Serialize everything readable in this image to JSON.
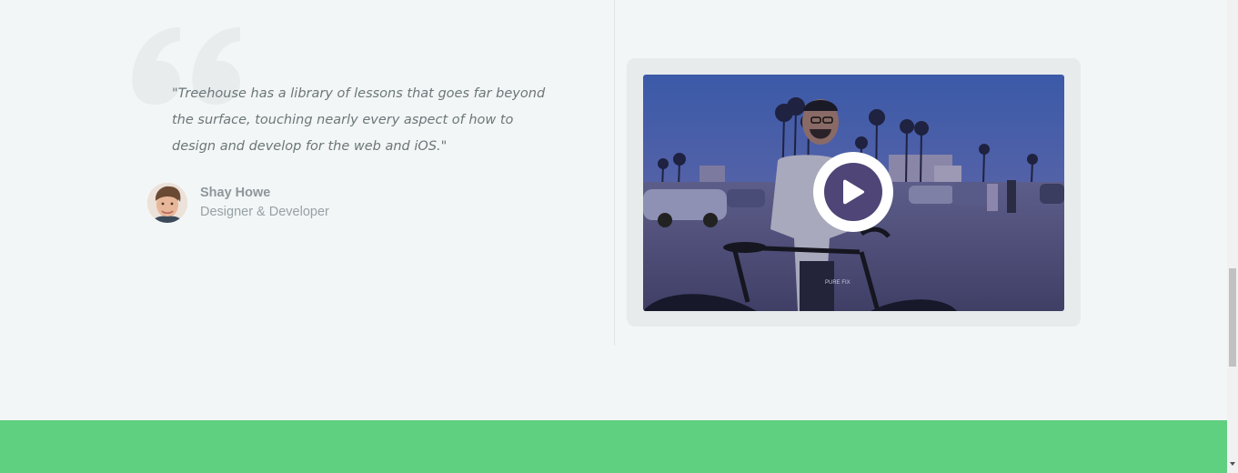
{
  "testimonial": {
    "quote": "\"Treehouse has a library of lessons that goes far beyond the surface, touching nearly every aspect of how to design and develop for the web and iOS.\"",
    "author_name": "Shay Howe",
    "author_role": "Designer & Developer"
  },
  "video": {
    "play_icon": "play-icon",
    "thumbnail_text": "PURE FIX"
  },
  "colors": {
    "background": "#f3f6f6",
    "accent_green": "#5fcf80",
    "play_button_inner": "#4f4577",
    "quote_mark": "#e8eced"
  }
}
